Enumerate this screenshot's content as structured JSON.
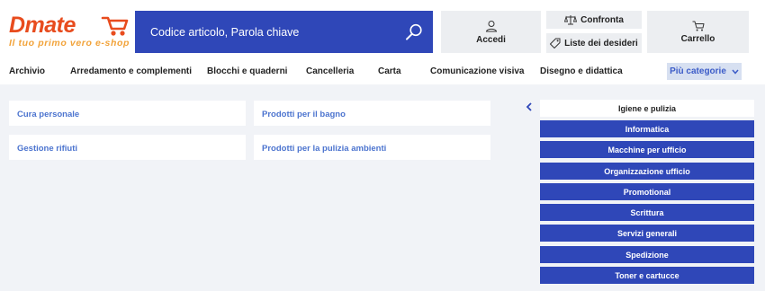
{
  "brand": {
    "logo_text": "Dmate",
    "tagline": "Il tuo primo vero e-shop",
    "colors": {
      "primary": "#2f47b8",
      "logo_orange": "#e84c1e",
      "tagline": "#f2a33a",
      "link": "#4c74cf"
    }
  },
  "search": {
    "placeholder": "Codice articolo, Parola chiave",
    "icon": "search-icon"
  },
  "header_buttons": {
    "accedi": {
      "label": "Accedi",
      "icon": "user-icon"
    },
    "confronta": {
      "label": "Confronta",
      "icon": "scale-icon"
    },
    "liste": {
      "label": "Liste dei desideri",
      "icon": "tag-icon"
    },
    "carrello": {
      "label": "Carrello",
      "icon": "cart-icon"
    }
  },
  "nav": {
    "items": [
      "Archivio",
      "Arredamento e complementi",
      "Blocchi e quaderni",
      "Cancelleria",
      "Carta",
      "Comunicazione visiva",
      "Disegno e didattica"
    ],
    "more_label": "Più categorie"
  },
  "subcategories": [
    "Cura personale",
    "Prodotti per il bagno",
    "Gestione rifiuti",
    "Prodotti per la pulizia ambienti"
  ],
  "category_menu": {
    "back_icon": "chevron-left-icon",
    "items": [
      {
        "label": "Igiene e pulizia",
        "active": true
      },
      {
        "label": "Informatica",
        "active": false
      },
      {
        "label": "Macchine per ufficio",
        "active": false
      },
      {
        "label": "Organizzazione ufficio",
        "active": false
      },
      {
        "label": "Promotional",
        "active": false
      },
      {
        "label": "Scrittura",
        "active": false
      },
      {
        "label": "Servizi generali",
        "active": false
      },
      {
        "label": "Spedizione",
        "active": false
      },
      {
        "label": "Toner e cartucce",
        "active": false
      }
    ]
  }
}
